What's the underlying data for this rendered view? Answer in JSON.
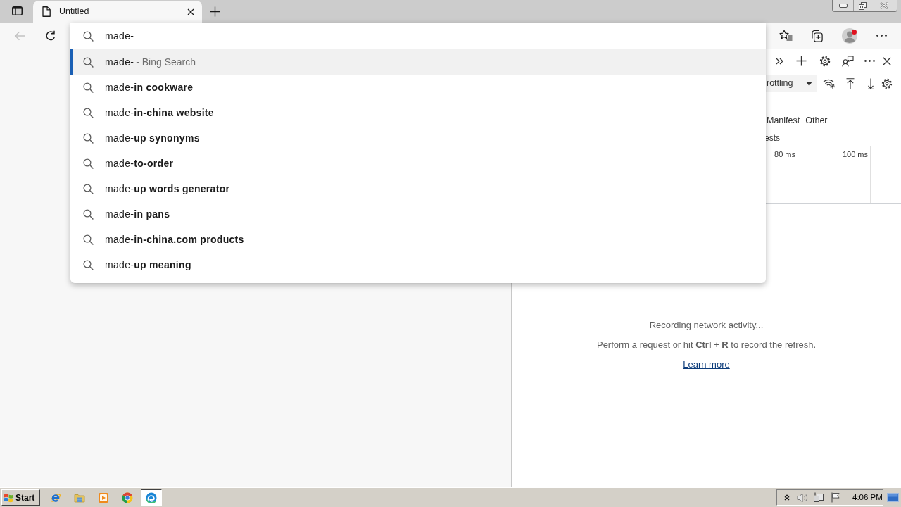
{
  "tabs": [
    {
      "title": "Untitled",
      "selected": true
    }
  ],
  "back_button": {
    "disabled": true
  },
  "address_bar": {
    "value": "made-"
  },
  "suggestions": [
    {
      "text": "made-",
      "source": "- Bing Search",
      "selected": true
    },
    {
      "text": "made-**in cookware**",
      "selected": false
    },
    {
      "text": "made-**in-china website**",
      "selected": false
    },
    {
      "text": "made-**up synonyms**",
      "selected": false
    },
    {
      "text": "made-**to-order**",
      "selected": false
    },
    {
      "text": "made-**up words generator**",
      "selected": false
    },
    {
      "text": "made-**in pans**",
      "selected": false
    },
    {
      "text": "made-**in-china.com products**",
      "selected": false
    },
    {
      "text": "made-**up meaning**",
      "selected": false
    }
  ],
  "devtools": {
    "throttling": "rottling",
    "resource_types": [
      "Manifest",
      "Other"
    ],
    "filter_option": "ests",
    "timeline_ticks": [
      "80 ms",
      "100 ms"
    ],
    "empty_state": {
      "title": "Recording network activity...",
      "hint": "Perform a request or hit **Ctrl** + **R** to record the refresh.",
      "link": "Learn more"
    }
  },
  "taskbar": {
    "start": "Start",
    "apps": [
      {
        "selected": false
      },
      {
        "selected": false
      },
      {
        "selected": false
      },
      {
        "selected": false
      },
      {
        "selected": true
      }
    ],
    "clock": "4:06 PM"
  }
}
